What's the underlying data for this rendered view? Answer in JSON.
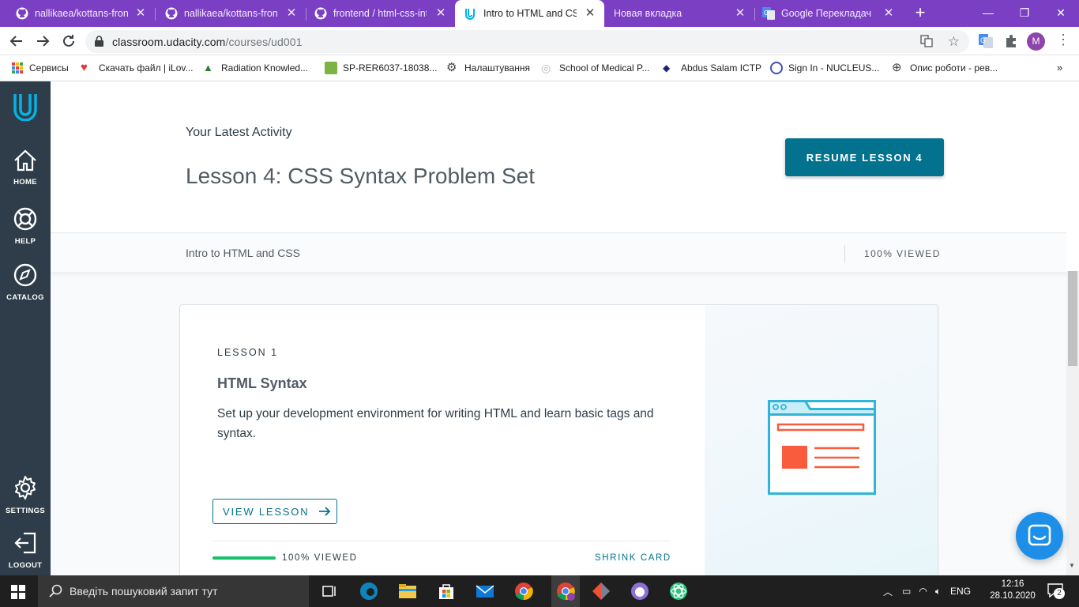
{
  "browser": {
    "tabs": [
      {
        "title": "nallikaea/kottans-frontend",
        "icon": "github-icon",
        "active": false
      },
      {
        "title": "nallikaea/kottans-frontend",
        "icon": "github-icon",
        "active": false
      },
      {
        "title": "frontend / html-css-intro",
        "icon": "github-icon",
        "active": false
      },
      {
        "title": "Intro to HTML and CSS",
        "icon": "udacity-icon",
        "active": true
      },
      {
        "title": "Новая вкладка",
        "icon": "",
        "active": false
      },
      {
        "title": "Google Перекладач",
        "icon": "google-translate-icon",
        "active": false
      }
    ],
    "url_host": "classroom.udacity.com",
    "url_path": "/courses/ud001",
    "profile_initial": "M",
    "bookmarks": [
      {
        "label": "Сервисы",
        "icon": "apps-icon"
      },
      {
        "label": "Скачать файл | iLov...",
        "icon": "heart-icon"
      },
      {
        "label": "Radiation Knowled...",
        "icon": "radiation-icon"
      },
      {
        "label": "SP-RER6037-18038...",
        "icon": "image-icon"
      },
      {
        "label": "Налаштування",
        "icon": "gear-icon"
      },
      {
        "label": "School of Medical P...",
        "icon": "globe-icon"
      },
      {
        "label": "Abdus Salam ICTP",
        "icon": "ictp-icon"
      },
      {
        "label": "Sign In - NUCLEUS...",
        "icon": "iaea-icon"
      },
      {
        "label": "Опис роботи - рев...",
        "icon": "globe-icon"
      }
    ]
  },
  "sidebar": {
    "items": [
      {
        "label": "HOME",
        "icon": "home-icon"
      },
      {
        "label": "HELP",
        "icon": "lifebuoy-icon"
      },
      {
        "label": "CATALOG",
        "icon": "compass-icon"
      },
      {
        "label": "SETTINGS",
        "icon": "gear-icon"
      },
      {
        "label": "LOGOUT",
        "icon": "logout-icon"
      }
    ]
  },
  "hero": {
    "eyebrow": "Your Latest Activity",
    "title": "Lesson 4: CSS Syntax Problem Set",
    "resume_label": "RESUME LESSON 4"
  },
  "course_bar": {
    "course_name": "Intro to HTML and CSS",
    "viewed": "100% VIEWED"
  },
  "lesson_card": {
    "number": "LESSON 1",
    "title": "HTML Syntax",
    "description": "Set up your development environment for writing HTML and learn basic tags and syntax.",
    "view_label": "VIEW LESSON",
    "progress_percent": 100,
    "viewed": "100% VIEWED",
    "shrink_label": "SHRINK CARD"
  },
  "colors": {
    "accent": "#02728e",
    "sidebar": "#2e3d49",
    "tabstrip": "#7b3fc4",
    "illustration_orange": "#f95c3c",
    "illustration_blue": "#2fb5d9"
  },
  "taskbar": {
    "search_placeholder": "Введіть пошуковий запит тут",
    "language": "ENG",
    "time": "12:16",
    "date": "28.10.2020",
    "notifications": "2"
  }
}
